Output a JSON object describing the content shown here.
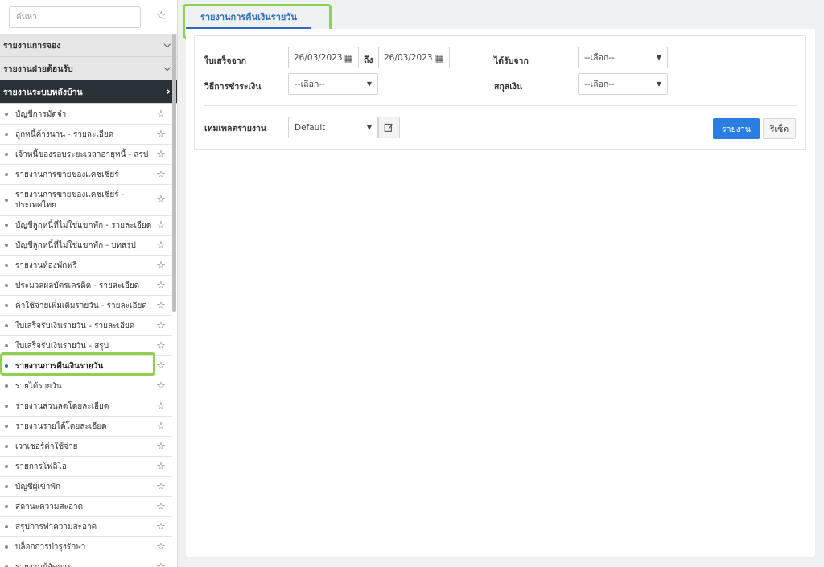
{
  "sidebar": {
    "search_placeholder": "ค้นหา",
    "sections": [
      {
        "label": "รายงานการจอง"
      },
      {
        "label": "รายงานฝ่ายต้อนรับ"
      },
      {
        "label": "รายงานระบบหลังบ้าน"
      }
    ],
    "items": [
      {
        "label": "บัญชีการมัดจำ"
      },
      {
        "label": "ลูกหนี้ค้างนาน - รายละเอียด"
      },
      {
        "label": "เจ้าหนี้ของรอบระยะเวลาอายุหนี้ - สรุป"
      },
      {
        "label": "รายงานการขายของแคชเชียร์"
      },
      {
        "label": "รายงานการขายของแคชเชียร์ - ประเทศไทย"
      },
      {
        "label": "บัญชีลูกหนี้ที่ไม่ใช่แขกพัก - รายละเอียด"
      },
      {
        "label": "บัญชีลูกหนี้ที่ไม่ใช่แขกพัก - บทสรุป"
      },
      {
        "label": "รายงานห้องพักฟรี"
      },
      {
        "label": "ประมวลผลบัตรเครดิต - รายละเอียด"
      },
      {
        "label": "ค่าใช้จ่ายเพิ่มเติมรายวัน - รายละเอียด"
      },
      {
        "label": "ใบเสร็จรับเงินรายวัน - รายละเอียด"
      },
      {
        "label": "ใบเสร็จรับเงินรายวัน - สรุป"
      },
      {
        "label": "รายงานการคืนเงินรายวัน"
      },
      {
        "label": "รายได้รายวัน"
      },
      {
        "label": "รายงานส่วนลดโดยละเอียด"
      },
      {
        "label": "รายงานรายได้โดยละเอียด"
      },
      {
        "label": "เวาเชอร์ค่าใช้จ่าย"
      },
      {
        "label": "รายการโฟลิโอ"
      },
      {
        "label": "บัญชีผู้เข้าพัก"
      },
      {
        "label": "สถานะความสะอาด"
      },
      {
        "label": "สรุปการทำความสะอาด"
      },
      {
        "label": "บล็อกการบำรุงรักษา"
      },
      {
        "label": "รายงานผู้จัดการ"
      }
    ]
  },
  "tab": {
    "label": "รายงานการคืนเงินรายวัน"
  },
  "filters": {
    "receipt_from_label": "ใบเสร็จจาก",
    "date_from": "26/03/2023",
    "to_label": "ถึง",
    "date_to": "26/03/2023",
    "received_from_label": "ได้รับจาก",
    "received_from_value": "--เลือก--",
    "payment_method_label": "วิธีการชำระเงิน",
    "payment_method_value": "--เลือก--",
    "currency_label": "สกุลเงิน",
    "currency_value": "--เลือก--",
    "template_label": "เทมเพลตรายงาน",
    "template_value": "Default",
    "report_button": "รายงาน",
    "reset_button": "รีเซ็ต"
  },
  "colors": {
    "accent": "#2a7de1",
    "highlight": "#8fd14f",
    "active_section": "#2a3137"
  }
}
